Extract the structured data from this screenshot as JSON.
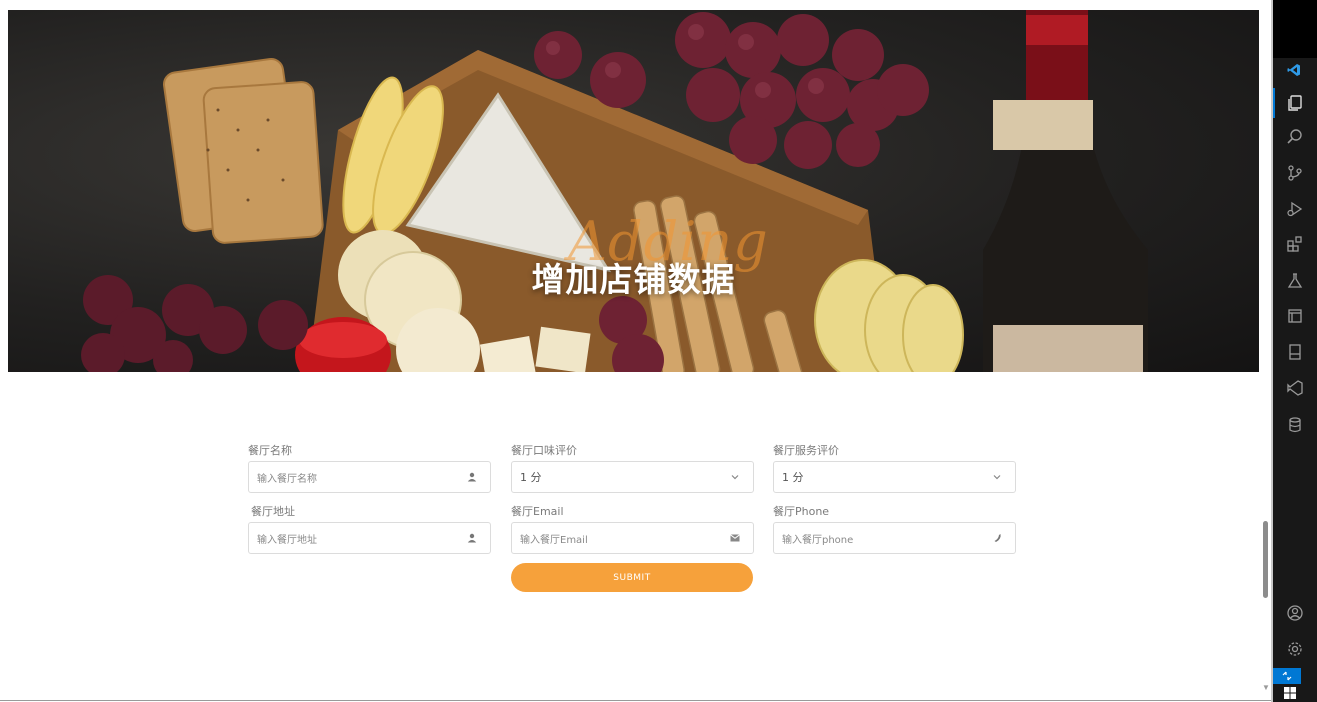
{
  "hero": {
    "title": "增加店铺数据",
    "script_text": "Adding"
  },
  "form": {
    "fields": [
      {
        "label": "餐厅名称",
        "placeholder": "输入餐厅名称",
        "icon": "user-icon"
      },
      {
        "label": "餐厅口味评价",
        "value": "1 分",
        "icon": "chevron-down-icon"
      },
      {
        "label": "餐厅服务评价",
        "value": "1 分",
        "icon": "chevron-down-icon"
      },
      {
        "label": "餐厅地址",
        "placeholder": "输入餐厅地址",
        "icon": "user-icon"
      },
      {
        "label": "餐厅Email",
        "placeholder": "输入餐厅Email",
        "icon": "envelope-icon"
      },
      {
        "label": "餐厅Phone",
        "placeholder": "输入餐厅phone",
        "icon": "phone-icon"
      }
    ],
    "submit_label": "SUBMIT"
  },
  "colors": {
    "accent": "#f6a13b",
    "vscode_blue": "#0078d4",
    "activity_bg": "#181818"
  },
  "activity_bar": {
    "icons": [
      "explorer-icon",
      "search-icon",
      "source-control-icon",
      "run-debug-icon",
      "extensions-icon",
      "testing-icon",
      "remote-explorer-icon",
      "notebook-icon",
      "visual-studio-icon",
      "database-icon",
      "account-icon",
      "settings-gear-icon"
    ]
  }
}
